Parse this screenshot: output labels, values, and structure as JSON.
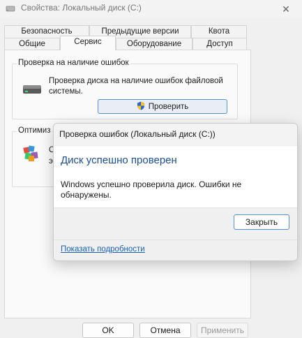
{
  "window": {
    "title": "Свойства: Локальный диск (C:)",
    "close_glyph": "✕"
  },
  "tabs": {
    "row1": [
      "Безопасность",
      "Предыдущие версии",
      "Квота"
    ],
    "row2": [
      "Общие",
      "Сервис",
      "Оборудование",
      "Доступ"
    ],
    "active": "Сервис"
  },
  "check_group": {
    "title": "Проверка на наличие ошибок",
    "description_line1": "Проверка диска на наличие ошибок файловой",
    "description_line2": "системы.",
    "button_label": "Проверить"
  },
  "optimize_group": {
    "title_partial": "Оптимиз",
    "text_partial_1": "О",
    "text_partial_2": "э"
  },
  "footer": {
    "ok_label": "OK",
    "cancel_label": "Отмена",
    "apply_label": "Применить"
  },
  "dialog": {
    "title": "Проверка ошибок (Локальный диск (C:))",
    "heading": "Диск успешно проверен",
    "message": "Windows успешно проверила диск. Ошибки не обнаружены.",
    "close_label": "Закрыть",
    "details_link": "Показать подробности"
  },
  "colors": {
    "heading": "#1d4f91",
    "link": "#1a5fb4",
    "accent_border": "#5a8dd1"
  }
}
